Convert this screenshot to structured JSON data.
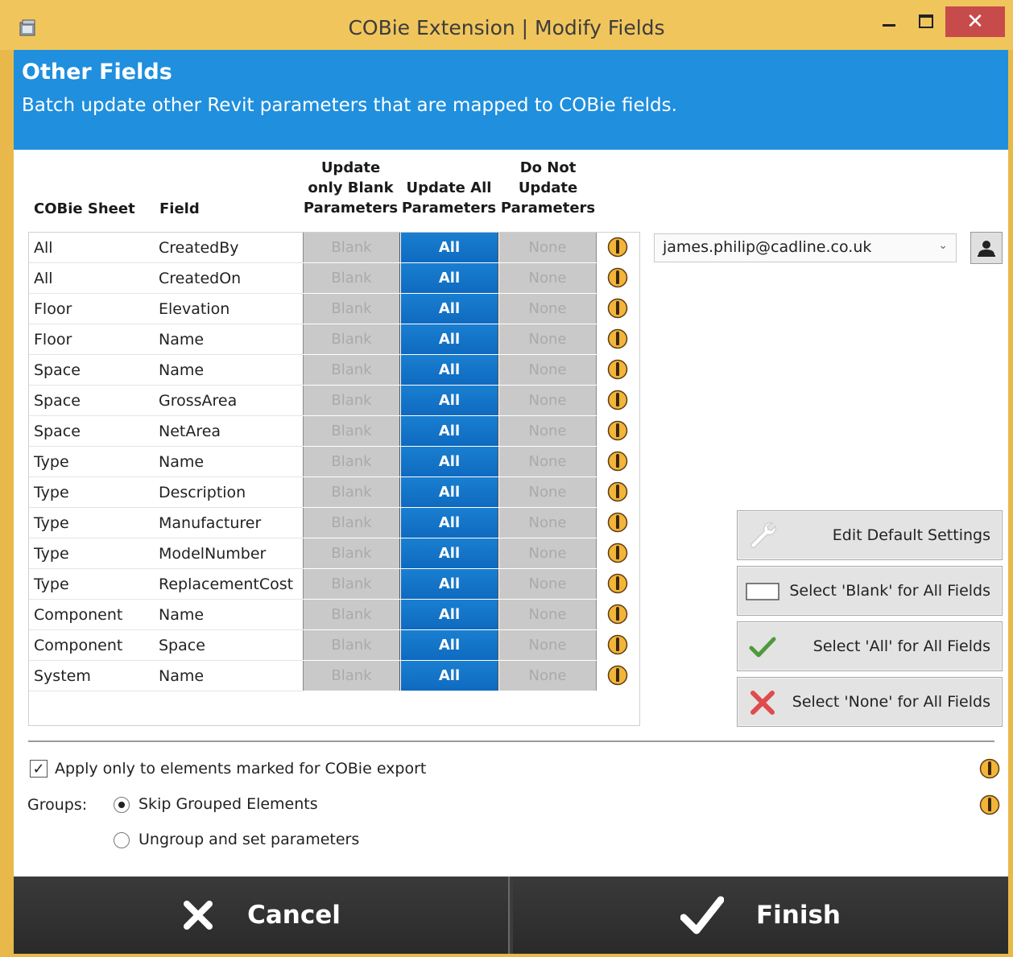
{
  "window": {
    "title": "COBie Extension | Modify Fields",
    "minimize_label": "–",
    "close_label": "✕"
  },
  "header": {
    "title": "Other Fields",
    "subtitle": "Batch update other Revit parameters that are mapped to COBie fields."
  },
  "columns": {
    "sheet": "COBie Sheet",
    "field": "Field",
    "blank": [
      "Update",
      "only Blank",
      "Parameters"
    ],
    "all": [
      "Update All",
      "Parameters"
    ],
    "none": [
      "Do Not",
      "Update",
      "Parameters"
    ]
  },
  "rows": [
    {
      "sheet": "All",
      "field": "CreatedBy",
      "blank": "Blank",
      "all": "All",
      "none": "None"
    },
    {
      "sheet": "All",
      "field": "CreatedOn",
      "blank": "Blank",
      "all": "All",
      "none": "None"
    },
    {
      "sheet": "Floor",
      "field": "Elevation",
      "blank": "Blank",
      "all": "All",
      "none": "None"
    },
    {
      "sheet": "Floor",
      "field": "Name",
      "blank": "Blank",
      "all": "All",
      "none": "None"
    },
    {
      "sheet": "Space",
      "field": "Name",
      "blank": "Blank",
      "all": "All",
      "none": "None"
    },
    {
      "sheet": "Space",
      "field": "GrossArea",
      "blank": "Blank",
      "all": "All",
      "none": "None"
    },
    {
      "sheet": "Space",
      "field": "NetArea",
      "blank": "Blank",
      "all": "All",
      "none": "None"
    },
    {
      "sheet": "Type",
      "field": "Name",
      "blank": "Blank",
      "all": "All",
      "none": "None"
    },
    {
      "sheet": "Type",
      "field": "Description",
      "blank": "Blank",
      "all": "All",
      "none": "None"
    },
    {
      "sheet": "Type",
      "field": "Manufacturer",
      "blank": "Blank",
      "all": "All",
      "none": "None"
    },
    {
      "sheet": "Type",
      "field": "ModelNumber",
      "blank": "Blank",
      "all": "All",
      "none": "None"
    },
    {
      "sheet": "Type",
      "field": "ReplacementCost",
      "blank": "Blank",
      "all": "All",
      "none": "None"
    },
    {
      "sheet": "Component",
      "field": "Name",
      "blank": "Blank",
      "all": "All",
      "none": "None"
    },
    {
      "sheet": "Component",
      "field": "Space",
      "blank": "Blank",
      "all": "All",
      "none": "None"
    },
    {
      "sheet": "System",
      "field": "Name",
      "blank": "Blank",
      "all": "All",
      "none": "None"
    }
  ],
  "selected_option": "all",
  "user": {
    "email": "james.philip@cadline.co.uk"
  },
  "side_buttons": {
    "edit_defaults": "Edit Default Settings",
    "select_blank": "Select 'Blank' for All Fields",
    "select_all": "Select 'All' for All Fields",
    "select_none": "Select 'None' for All Fields"
  },
  "options": {
    "apply_only_marked": "Apply only to elements marked for COBie export",
    "apply_only_marked_checked": true,
    "groups_label": "Groups:",
    "skip_grouped": "Skip Grouped Elements",
    "ungroup": "Ungroup and set parameters",
    "groups_selected": "skip"
  },
  "footer": {
    "cancel": "Cancel",
    "finish": "Finish"
  },
  "colors": {
    "title_bar": "#f0c55c",
    "header_blue": "#1f8fde",
    "selected_option": "#0e6ac0",
    "close_red": "#c74b4b",
    "footer_dark": "#2a2a2a"
  }
}
